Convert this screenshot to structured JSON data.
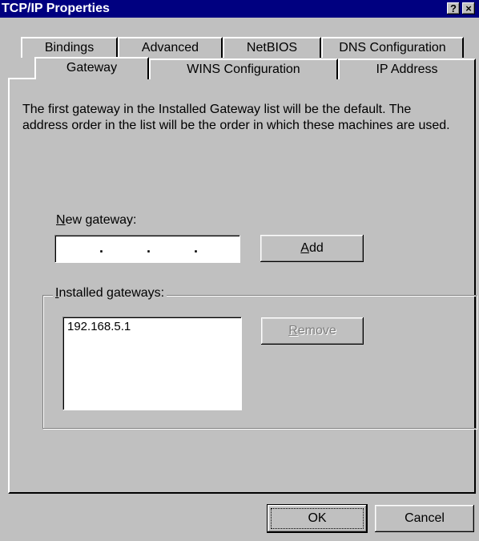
{
  "window": {
    "title": "TCP/IP Properties",
    "help_button": "?",
    "close_button": "×"
  },
  "tabs": {
    "row1": [
      "Bindings",
      "Advanced",
      "NetBIOS",
      "DNS Configuration"
    ],
    "row2": [
      "Gateway",
      "WINS Configuration",
      "IP Address"
    ],
    "active": "Gateway"
  },
  "gateway": {
    "description": "The first gateway in the Installed Gateway list will be the default. The address order in the list will be the order in which these machines are used.",
    "new_gateway_label": {
      "accel": "N",
      "rest": "ew gateway:"
    },
    "ip_dots": [
      ".",
      ".",
      "."
    ],
    "add_button": {
      "accel": "A",
      "rest": "dd"
    },
    "installed_label": {
      "accel": "I",
      "rest": "nstalled gateways:"
    },
    "installed_items": [
      "192.168.5.1"
    ],
    "remove_button": {
      "accel": "R",
      "rest": "emove"
    }
  },
  "footer": {
    "ok_label": "OK",
    "cancel_label": "Cancel"
  }
}
